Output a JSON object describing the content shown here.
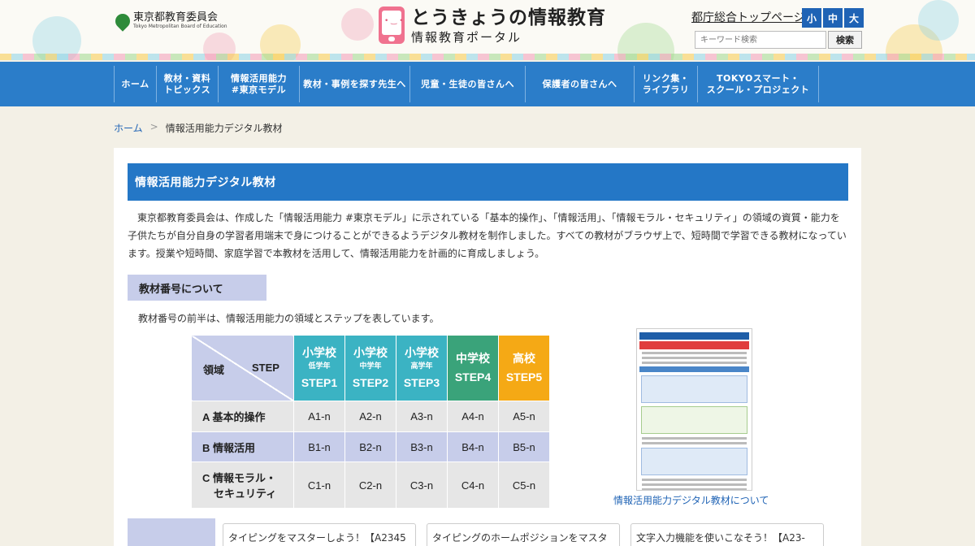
{
  "header": {
    "board_name": "東京都教育委員会",
    "board_name_en": "Tokyo Metropolitan Board of Education",
    "site_title": "とうきょうの情報教育",
    "site_subtitle": "情報教育ポータル",
    "top_link": "都庁総合トップページ",
    "font_sizes": [
      "小",
      "中",
      "大"
    ],
    "search_placeholder": "キーワード検索",
    "search_button": "検索"
  },
  "nav": {
    "items": [
      {
        "label": "ホーム"
      },
      {
        "label": "教材・資料\nトピックス"
      },
      {
        "label": "情報活用能力\n#東京モデル"
      },
      {
        "label": "教材・事例を探す先生へ"
      },
      {
        "label": "児童・生徒の皆さんへ"
      },
      {
        "label": "保護者の皆さんへ"
      },
      {
        "label": "リンク集・\nライブラリ"
      },
      {
        "label": "TOKYOスマート・\nスクール・プロジェクト"
      }
    ]
  },
  "breadcrumb": {
    "home": "ホーム",
    "separator": ">",
    "current": "情報活用能力デジタル教材"
  },
  "main": {
    "title": "情報活用能力デジタル教材",
    "intro": "東京都教育委員会は、作成した「情報活用能力 #東京モデル」に示されている「基本的操作」、「情報活用」、「情報モラル・セキュリティ」の領域の資質・能力を子供たちが自分自身の学習者用端末で身につけることができるようデジタル教材を制作しました。すべての教材がブラウザ上で、短時間で学習できる教材になっています。授業や短時間、家庭学習で本教材を活用して、情報活用能力を計画的に育成しましょう。",
    "section_heading": "教材番号について",
    "section_text": "教材番号の前半は、情報活用能力の領域とステップを表しています。"
  },
  "step_table": {
    "corner_left": "領域",
    "corner_right": "STEP",
    "columns": [
      {
        "school": "小学校",
        "grade": "低学年",
        "step": "STEP1",
        "color": "#3bb3c3"
      },
      {
        "school": "小学校",
        "grade": "中学年",
        "step": "STEP2",
        "color": "#3bb3c3"
      },
      {
        "school": "小学校",
        "grade": "高学年",
        "step": "STEP3",
        "color": "#3bb3c3"
      },
      {
        "school": "中学校",
        "grade": "",
        "step": "STEP4",
        "color": "#3aa37a"
      },
      {
        "school": "高校",
        "grade": "",
        "step": "STEP5",
        "color": "#f5a915"
      }
    ],
    "rows": [
      {
        "label": "A 基本的操作",
        "cells": [
          "A1-n",
          "A2-n",
          "A3-n",
          "A4-n",
          "A5-n"
        ]
      },
      {
        "label": "B 情報活用",
        "cells": [
          "B1-n",
          "B2-n",
          "B3-n",
          "B4-n",
          "B5-n"
        ]
      },
      {
        "label_line1": "C 情報モラル・",
        "label_line2": "セキュリティ",
        "cells": [
          "C1-n",
          "C2-n",
          "C3-n",
          "C4-n",
          "C5-n"
        ]
      }
    ]
  },
  "side_doc": {
    "link_text": "情報活用能力デジタル教材について"
  },
  "bottom_cards": [
    "タイピングをマスターしよう！【A2345",
    "タイピングのホームポジションをマスタ",
    "文字入力機能を使いこなそう！【A23-"
  ],
  "colors": {
    "nav_blue": "#2b7dc9",
    "title_blue": "#2477c6",
    "lavender": "#c7cdea",
    "teal": "#3bb3c3",
    "green": "#3aa37a",
    "orange": "#f5a915"
  }
}
